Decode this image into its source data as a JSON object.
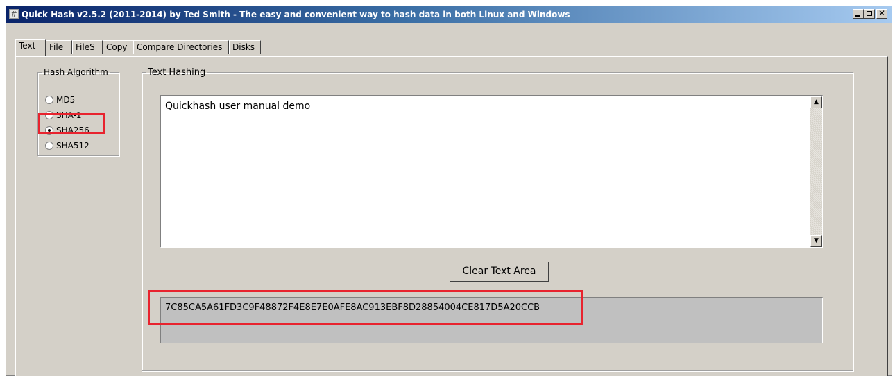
{
  "window": {
    "title": "Quick Hash v2.5.2 (2011-2014) by Ted Smith - The easy and convenient way to hash data in both Linux and Windows",
    "icon": "hash-icon",
    "controls": {
      "minimize": "minimize-icon",
      "maximize": "maximize-icon",
      "close": "✕"
    }
  },
  "tabs": [
    {
      "label": "Text",
      "active": true
    },
    {
      "label": "File",
      "active": false
    },
    {
      "label": "FileS",
      "active": false
    },
    {
      "label": "Copy",
      "active": false
    },
    {
      "label": "Compare Directories",
      "active": false
    },
    {
      "label": "Disks",
      "active": false
    }
  ],
  "hash_algorithm": {
    "legend": "Hash Algorithm",
    "options": [
      {
        "label": "MD5",
        "selected": false
      },
      {
        "label": "SHA-1",
        "selected": false
      },
      {
        "label": "SHA256",
        "selected": true
      },
      {
        "label": "SHA512",
        "selected": false
      }
    ]
  },
  "text_hashing": {
    "legend": "Text Hashing",
    "input_value": "Quickhash user manual demo",
    "clear_button_label": "Clear Text Area",
    "hash_output": "7C85CA5A61FD3C9F48872F4E8E7E0AFE8AC913EBF8D28854004CE817D5A20CCB"
  },
  "colors": {
    "highlight": "#e8232e",
    "window_face": "#d4d0c8",
    "titlebar_start": "#0a246a",
    "output_background": "#c0c0c0"
  }
}
